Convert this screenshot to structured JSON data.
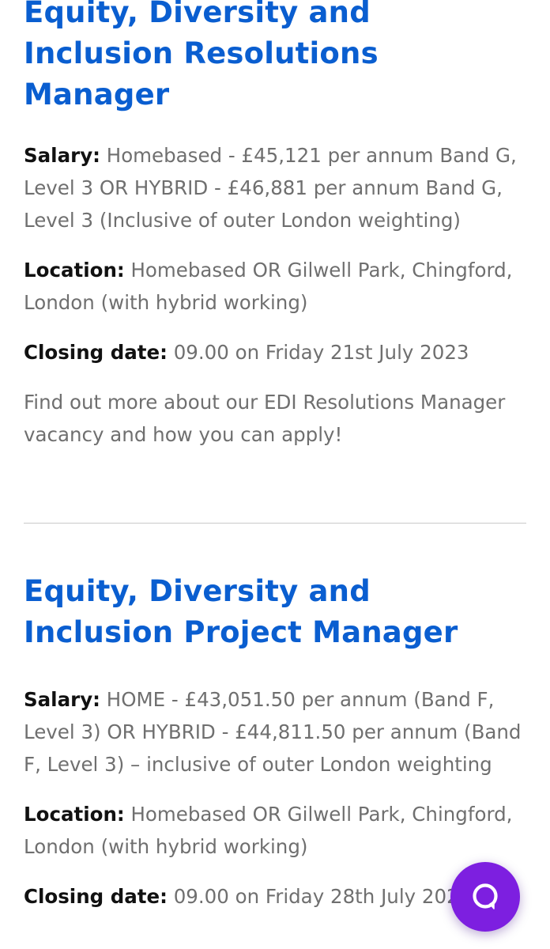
{
  "jobs": [
    {
      "title": "Equity, Diversity and Inclusion Resolutions Manager",
      "salary_label": "Salary:",
      "salary_value": "Homebased - £45,121 per annum Band G, Level 3 OR HYBRID - £46,881 per annum Band G, Level 3 (Inclusive of outer London weighting)",
      "location_label": "Location:",
      "location_value": "Homebased OR Gilwell Park, Chingford, London (with hybrid working)",
      "closing_label": "Closing date:",
      "closing_value": "09.00 on Friday 21st July 2023",
      "more_text": "Find out more about our EDI Resolutions Manager vacancy and how you can apply!"
    },
    {
      "title": "Equity, Diversity and Inclusion Project Manager",
      "salary_label": "Salary:",
      "salary_value": "HOME - £43,051.50 per annum (Band F, Level 3) OR HYBRID - £44,811.50 per annum (Band F, Level 3) – inclusive of outer London weighting",
      "location_label": "Location:",
      "location_value": "Homebased OR Gilwell Park, Chingford, London (with hybrid working)",
      "closing_label": "Closing date:",
      "closing_value": "09.00 on Friday 28th July 2023"
    }
  ],
  "chat_widget": {
    "icon": "chat-bubble-icon",
    "background": "#7d1fe0"
  },
  "colors": {
    "title": "#0a5ed0",
    "label": "#111111",
    "body_text": "#6f6f6f",
    "divider": "#c9c9c9"
  }
}
